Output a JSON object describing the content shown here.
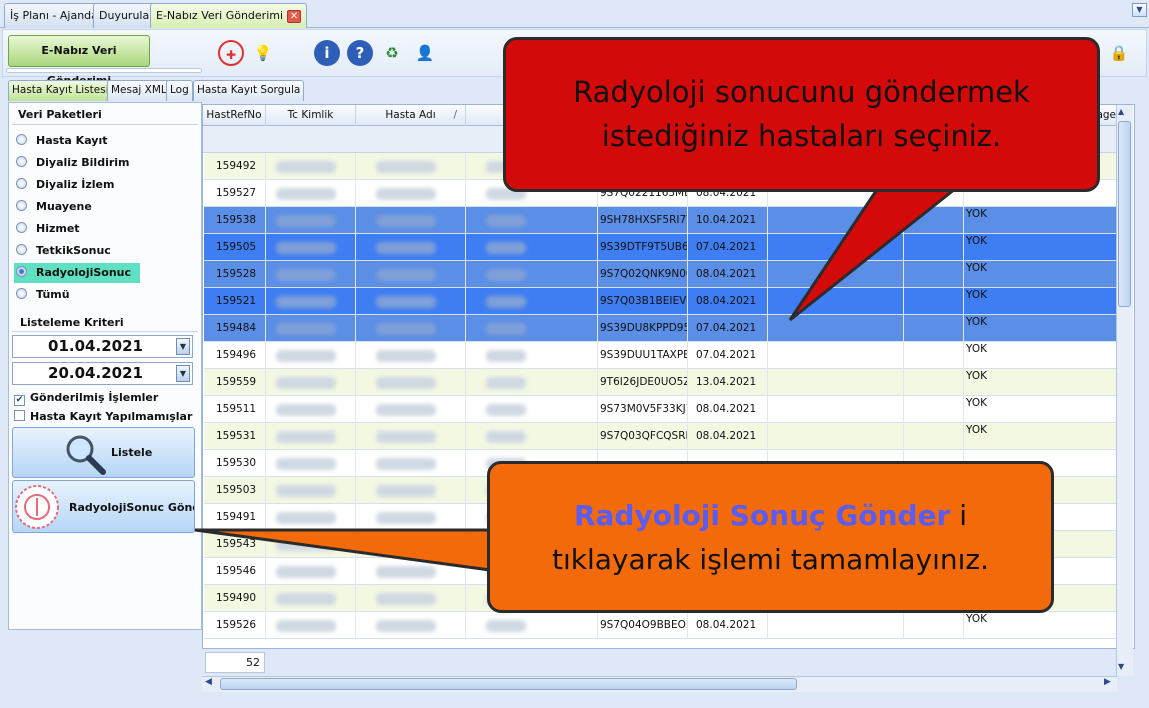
{
  "doc_tabs": [
    "İş Planı - Ajanda",
    "Duyurular",
    "E-Nabız Veri Gönderimi"
  ],
  "toolbar": {
    "title_button": "E-Nabız Veri Gönderimi"
  },
  "sub_tabs": [
    "Hasta Kayıt Listesi",
    "Mesaj XML",
    "Log",
    "Hasta Kayıt Sorgula"
  ],
  "left_panel": {
    "veri_paketleri_title": "Veri Paketleri",
    "items": [
      "Hasta Kayıt",
      "Diyaliz Bildirim",
      "Diyaliz İzlem",
      "Muayene",
      "Hizmet",
      "TetkikSonuc",
      "RadyolojiSonuc",
      "Tümü"
    ],
    "selected_item": "RadyolojiSonuc",
    "listeleme_title": "Listeleme Kriteri",
    "date_from": "01.04.2021",
    "date_to": "20.04.2021",
    "check_gonderilmis": "Gönderilmiş İşlemler",
    "check_gonderilmis_checked": true,
    "check_hasta_kayit": "Hasta Kayıt Yapılmamışlar",
    "check_hasta_kayit_checked": false,
    "listele_button": "Listele",
    "send_button": "RadyolojiSonuc Gönde"
  },
  "grid": {
    "headers": [
      "HastRefNo",
      "Tc Kimlik",
      "Hasta Adı",
      "age"
    ],
    "rows": [
      {
        "ref": "159492",
        "code": "",
        "date": "",
        "yok": "",
        "style": "odd"
      },
      {
        "ref": "159527",
        "code": "9S7Q0221163ML8",
        "date": "08.04.2021",
        "yok": "YOK",
        "style": "even"
      },
      {
        "ref": "159538",
        "code": "9SH78HXSF5RI7W",
        "date": "10.04.2021",
        "yok": "YOK",
        "style": "sel-a"
      },
      {
        "ref": "159505",
        "code": "9S39DTF9T5UB6N",
        "date": "07.04.2021",
        "yok": "YOK",
        "style": "sel-b"
      },
      {
        "ref": "159528",
        "code": "9S7Q02QNK9N0O",
        "date": "08.04.2021",
        "yok": "YOK",
        "style": "sel-a"
      },
      {
        "ref": "159521",
        "code": "9S7Q03B1BEIEV7",
        "date": "08.04.2021",
        "yok": "YOK",
        "style": "sel-b"
      },
      {
        "ref": "159484",
        "code": "9S39DU8KPPD953",
        "date": "07.04.2021",
        "yok": "YOK",
        "style": "sel-a"
      },
      {
        "ref": "159496",
        "code": "9S39DUU1TAXPE1",
        "date": "07.04.2021",
        "yok": "YOK",
        "style": "even"
      },
      {
        "ref": "159559",
        "code": "9T6I26JDE0UO5Z",
        "date": "13.04.2021",
        "yok": "YOK",
        "style": "odd"
      },
      {
        "ref": "159511",
        "code": "9S73M0V5F33KJ7",
        "date": "08.04.2021",
        "yok": "YOK",
        "style": "even"
      },
      {
        "ref": "159531",
        "code": "9S7Q03QFCQSRE",
        "date": "08.04.2021",
        "yok": "YOK",
        "style": "odd"
      },
      {
        "ref": "159530",
        "code": "",
        "date": "",
        "yok": "",
        "style": "even"
      },
      {
        "ref": "159503",
        "code": "",
        "date": "",
        "yok": "",
        "style": "odd"
      },
      {
        "ref": "159491",
        "code": "",
        "date": "",
        "yok": "",
        "style": "even"
      },
      {
        "ref": "159543",
        "code": "",
        "date": "",
        "yok": "",
        "style": "odd"
      },
      {
        "ref": "159546",
        "code": "",
        "date": "",
        "yok": "",
        "style": "even"
      },
      {
        "ref": "159490",
        "code": "",
        "date": "",
        "yok": "",
        "style": "odd"
      },
      {
        "ref": "159526",
        "code": "9S7Q04O9BBEOIF",
        "date": "08.04.2021",
        "yok": "YOK",
        "style": "even"
      }
    ],
    "footer_count": "52"
  },
  "callouts": {
    "red_line1": "Radyoloji sonucunu göndermek",
    "red_line2": "istediğiniz hastaları seçiniz.",
    "orange_highlight": "Radyoloji Sonuç Gönder",
    "orange_rest1": " i",
    "orange_line2": "tıklayarak işlemi tamamlayınız."
  }
}
